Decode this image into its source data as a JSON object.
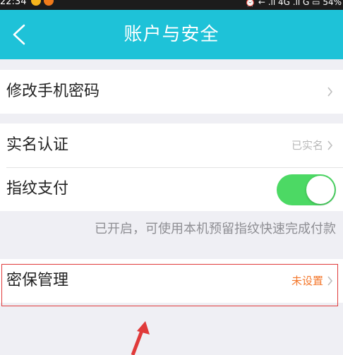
{
  "status_bar": {
    "time": "22:34",
    "right_text": "⏰ ← .ıl 4G .ıl G ▭ 54%"
  },
  "nav": {
    "title": "账户与安全",
    "back_icon": "chevron-left-icon"
  },
  "rows": {
    "change_password": {
      "label": "修改手机密码"
    },
    "real_name": {
      "label": "实名认证",
      "value": "已实名"
    },
    "fingerprint": {
      "label": "指纹支付",
      "enabled": true
    },
    "fingerprint_hint": "已开启，可使用本机预留指纹快速完成付款",
    "security_question": {
      "label": "密保管理",
      "value": "未设置"
    }
  },
  "colors": {
    "nav_bg": "#1ec2d8",
    "toggle_on": "#4cd964",
    "warning_text": "#f4772b",
    "annotation": "#e03a3a"
  }
}
